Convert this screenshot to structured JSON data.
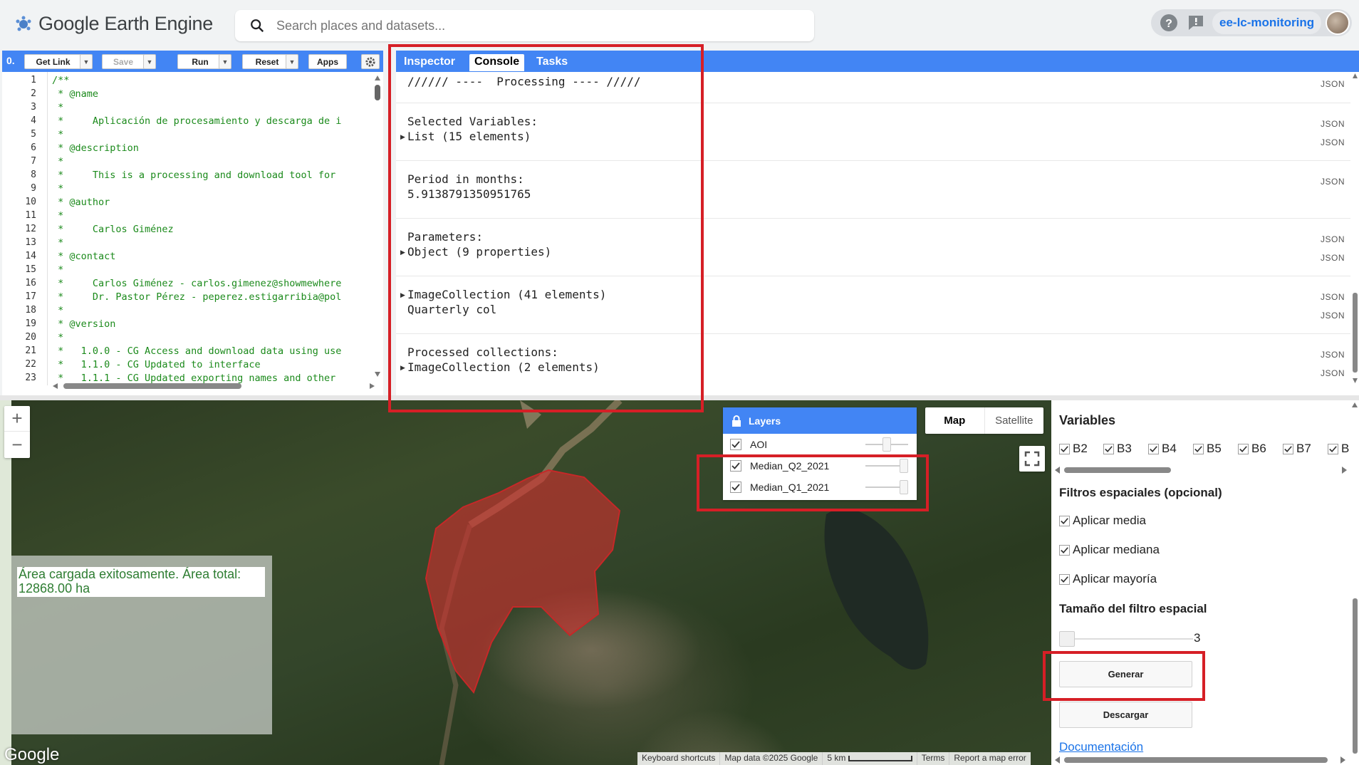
{
  "header": {
    "app_title": "Google Earth Engine",
    "search_placeholder": "Search places and datasets...",
    "project": "ee-lc-monitoring"
  },
  "editor_toolbar": {
    "counter": "0.",
    "get_link": "Get Link",
    "save": "Save",
    "run": "Run",
    "reset": "Reset",
    "apps": "Apps"
  },
  "editor": {
    "line_numbers": [
      "1",
      "2",
      "3",
      "4",
      "5",
      "6",
      "7",
      "8",
      "9",
      "10",
      "11",
      "12",
      "13",
      "14",
      "15",
      "16",
      "17",
      "18",
      "19",
      "20",
      "21",
      "22",
      "23"
    ],
    "lines": [
      "/**",
      " * @name",
      " *",
      " *     Aplicación de procesamiento y descarga de i",
      " *",
      " * @description",
      " *",
      " *     This is a processing and download tool for",
      " *",
      " * @author",
      " *",
      " *     Carlos Giménez",
      " *",
      " * @contact",
      " *",
      " *     Carlos Giménez - carlos.gimenez@showmewhere",
      " *     Dr. Pastor Pérez - peperez.estigarribia@pol",
      " *",
      " * @version",
      " *",
      " *   1.0.0 - CG Access and download data using use",
      " *   1.1.0 - CG Updated to interface",
      " *   1.1.1 - CG Updated exporting names and other"
    ]
  },
  "panel": {
    "tabs": [
      "Inspector",
      "Console",
      "Tasks"
    ],
    "active_tab": "Console"
  },
  "console": {
    "json_label": "JSON",
    "entries": [
      {
        "lines": [
          "////// ----  Processing ---- /////"
        ]
      },
      {
        "lines": [
          "Selected Variables:",
          "List (15 elements)"
        ]
      },
      {
        "lines": [
          "Period in months:",
          "5.9138791350951765"
        ]
      },
      {
        "lines": [
          "Parameters:",
          "Object (9 properties)"
        ]
      },
      {
        "lines": [
          "ImageCollection (41 elements)",
          "Quarterly col"
        ]
      },
      {
        "lines": [
          "Processed collections:",
          "ImageCollection (2 elements)"
        ]
      }
    ]
  },
  "map": {
    "zoom_in": "+",
    "zoom_out": "−",
    "info_message": "Área cargada exitosamente. Área total: 12868.00 ha",
    "google_logo": "Google",
    "map_types": [
      "Map",
      "Satellite"
    ],
    "layers_title": "Layers",
    "layers": [
      {
        "name": "AOI",
        "checked": true
      },
      {
        "name": "Median_Q2_2021",
        "checked": true
      },
      {
        "name": "Median_Q1_2021",
        "checked": true
      }
    ],
    "attribution": [
      "Keyboard shortcuts",
      "Map data ©2025 Google",
      "5 km",
      "Terms",
      "Report a map error"
    ],
    "aoi_color": "#d32f2f"
  },
  "sidebar": {
    "variables_title": "Variables",
    "variables": [
      "B2",
      "B3",
      "B4",
      "B5",
      "B6",
      "B7",
      "B"
    ],
    "spatial_filters_title": "Filtros espaciales (opcional)",
    "filters": [
      "Aplicar media",
      "Aplicar mediana",
      "Aplicar mayoría"
    ],
    "filter_size_title": "Tamaño del filtro espacial",
    "filter_size_value": "3",
    "generate_button": "Generar",
    "download_button": "Descargar",
    "documentation_link": "Documentación"
  },
  "colors": {
    "toolbar_blue": "#4285f4",
    "highlight_red": "#d61f26",
    "code_green": "#1b8a1b",
    "success_green": "#2e7d32"
  }
}
